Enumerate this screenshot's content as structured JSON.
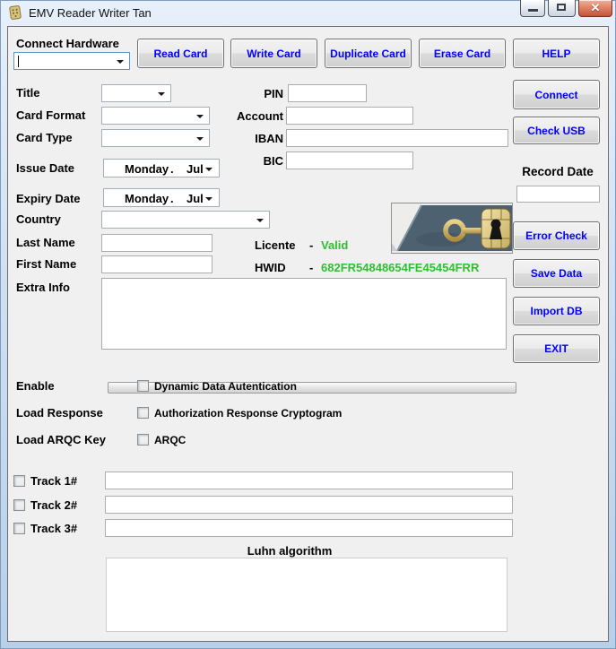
{
  "window": {
    "title": "EMV Reader Writer Tan"
  },
  "icons": {
    "app": "chip-card-icon",
    "minimize": "minimize-icon",
    "maximize": "maximize-icon",
    "close": "close-icon",
    "close_glyph": "✕",
    "dropdown": "chevron-down-icon",
    "picture": "key-in-chip-image"
  },
  "toolbar": {
    "connect_hardware_label": "Connect Hardware",
    "connect_hardware_value": "",
    "read_card": "Read Card",
    "write_card": "Write Card",
    "duplicate_card": "Duplicate Card",
    "erase_card": "Erase Card",
    "help": "HELP"
  },
  "form": {
    "title": {
      "label": "Title",
      "value": ""
    },
    "card_format": {
      "label": "Card Format",
      "value": ""
    },
    "card_type": {
      "label": "Card Type",
      "value": ""
    },
    "issue_date": {
      "label": "Issue Date",
      "day": "Monday",
      "separator": ".",
      "month": "Jul"
    },
    "expiry_date": {
      "label": "Expiry Date",
      "day": "Monday",
      "separator": ".",
      "month": "Jul"
    },
    "country": {
      "label": "Country",
      "value": ""
    },
    "last_name": {
      "label": "Last Name",
      "value": ""
    },
    "first_name": {
      "label": "First Name",
      "value": ""
    },
    "extra_info": {
      "label": "Extra Info",
      "value": ""
    },
    "pin": {
      "label": "PIN",
      "value": ""
    },
    "account": {
      "label": "Account",
      "value": ""
    },
    "iban": {
      "label": "IBAN",
      "value": ""
    },
    "bic": {
      "label": "BIC",
      "value": ""
    }
  },
  "license": {
    "licente_label": "Licente",
    "separator": "-",
    "licente_value": "Valid",
    "hwid_label": "HWID",
    "hwid_value": "682FR54848654FE45454FRR"
  },
  "options": {
    "enable_label": "Enable",
    "enable_checkbox": "Dynamic Data Autentication",
    "enable_checked": false,
    "load_response_label": "Load Response",
    "load_response_checkbox": "Authorization Response Cryptogram",
    "load_response_checked": false,
    "load_arqc_label": "Load ARQC Key",
    "load_arqc_checkbox": "ARQC",
    "load_arqc_checked": false
  },
  "tracks": [
    {
      "label": "Track 1#",
      "value": "",
      "checked": false
    },
    {
      "label": "Track 2#",
      "value": "",
      "checked": false
    },
    {
      "label": "Track 3#",
      "value": "",
      "checked": false
    }
  ],
  "luhn": {
    "label": "Luhn algorithm",
    "value": ""
  },
  "sidebar": {
    "connect": "Connect",
    "check_usb": "Check USB",
    "record_date_label": "Record Date",
    "record_date_value": "",
    "error_check": "Error Check",
    "save_data": "Save Data",
    "import_db": "Import DB",
    "exit": "EXIT"
  },
  "colors": {
    "button_text": "#0000ff",
    "valid_green": "#2fbf2f",
    "close_button_red": "#c4523a"
  }
}
